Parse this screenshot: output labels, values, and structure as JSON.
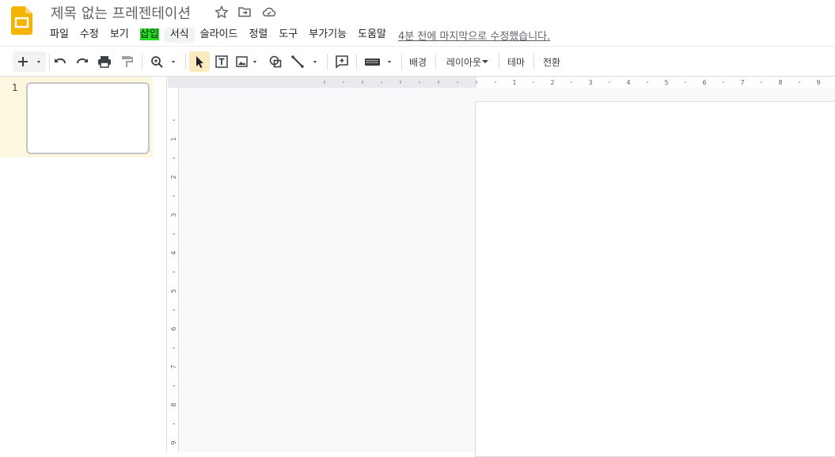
{
  "app": {
    "title": "제목 없는 프레젠테이션",
    "brand_color": "#f4b400",
    "last_edit": "4분 전에 마지막으로 수정했습니다."
  },
  "menu": [
    {
      "label": "파일"
    },
    {
      "label": "수정"
    },
    {
      "label": "보기"
    },
    {
      "label": "삽입",
      "highlight": "#22dd22"
    },
    {
      "label": "서식"
    },
    {
      "label": "슬라이드"
    },
    {
      "label": "정렬"
    },
    {
      "label": "도구"
    },
    {
      "label": "부가기능"
    },
    {
      "label": "도움말"
    }
  ],
  "toolbar": {
    "background_label": "배경",
    "layout_label": "레이아웃",
    "theme_label": "테마",
    "transition_label": "전환",
    "icons": [
      "plus-icon",
      "undo-icon",
      "redo-icon",
      "print-icon",
      "paint-format-icon",
      "zoom-icon",
      "select-cursor-icon",
      "text-box-icon",
      "image-icon",
      "shape-icon",
      "line-icon",
      "comment-icon",
      "keyboard-icon"
    ]
  },
  "filmstrip": {
    "slides": [
      {
        "number": "1"
      }
    ]
  },
  "ruler": {
    "top_labels": [
      "1",
      "2",
      "3",
      "4",
      "5",
      "6",
      "7",
      "8",
      "9"
    ],
    "left_labels": [
      "1",
      "2",
      "3",
      "4",
      "5",
      "6",
      "7",
      "8",
      "9"
    ]
  }
}
